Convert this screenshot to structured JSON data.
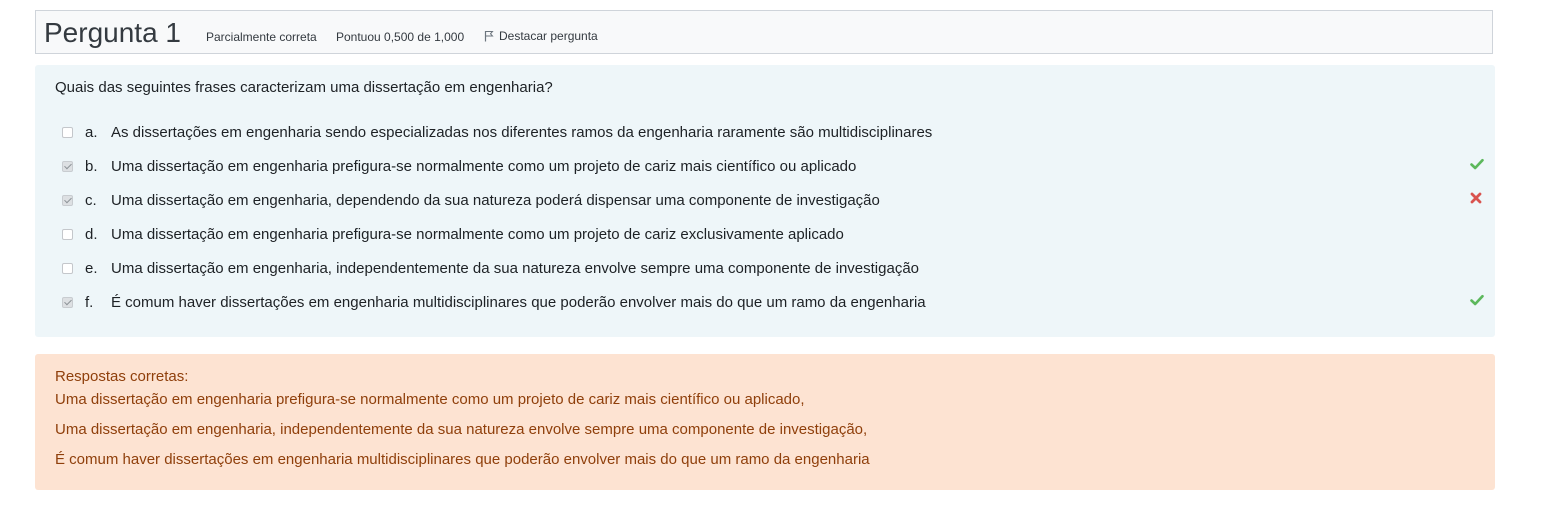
{
  "header": {
    "title": "Pergunta 1",
    "state": "Parcialmente correta",
    "grade": "Pontuou 0,500 de 1,000",
    "flag_label": "Destacar pergunta"
  },
  "question": {
    "text": "Quais das seguintes frases caracterizam uma dissertação em engenharia?",
    "options": [
      {
        "letter": "a.",
        "text": "As dissertações em engenharia sendo especializadas nos diferentes ramos da engenharia raramente são multidisciplinares",
        "checked": false,
        "mark": ""
      },
      {
        "letter": "b.",
        "text": "Uma dissertação em engenharia prefigura-se normalmente como um projeto de cariz mais científico ou aplicado",
        "checked": true,
        "mark": "correct"
      },
      {
        "letter": "c.",
        "text": "Uma dissertação em engenharia, dependendo da sua natureza poderá dispensar uma componente de investigação",
        "checked": true,
        "mark": "incorrect"
      },
      {
        "letter": "d.",
        "text": "Uma dissertação em engenharia prefigura-se normalmente como um projeto de cariz exclusivamente aplicado",
        "checked": false,
        "mark": ""
      },
      {
        "letter": "e.",
        "text": "Uma dissertação em engenharia, independentemente da sua natureza envolve sempre uma componente de investigação",
        "checked": false,
        "mark": ""
      },
      {
        "letter": "f.",
        "text": "É comum haver dissertações em engenharia multidisciplinares que poderão envolver mais do que um ramo da engenharia",
        "checked": true,
        "mark": "correct"
      }
    ]
  },
  "feedback": {
    "label": "Respostas corretas:",
    "answers": [
      "Uma dissertação em engenharia prefigura-se normalmente como um projeto de cariz mais científico ou aplicado,",
      "Uma dissertação em engenharia, independentemente da sua natureza envolve sempre uma componente de investigação,",
      "É comum haver dissertações em engenharia multidisciplinares que poderão envolver mais do que um ramo da engenharia"
    ]
  },
  "colors": {
    "correct": "#5cb85c",
    "incorrect": "#d9534f",
    "formulation_bg": "#eef6f9",
    "outcome_bg": "#fde3d2",
    "outcome_text": "#8f3f0b"
  }
}
